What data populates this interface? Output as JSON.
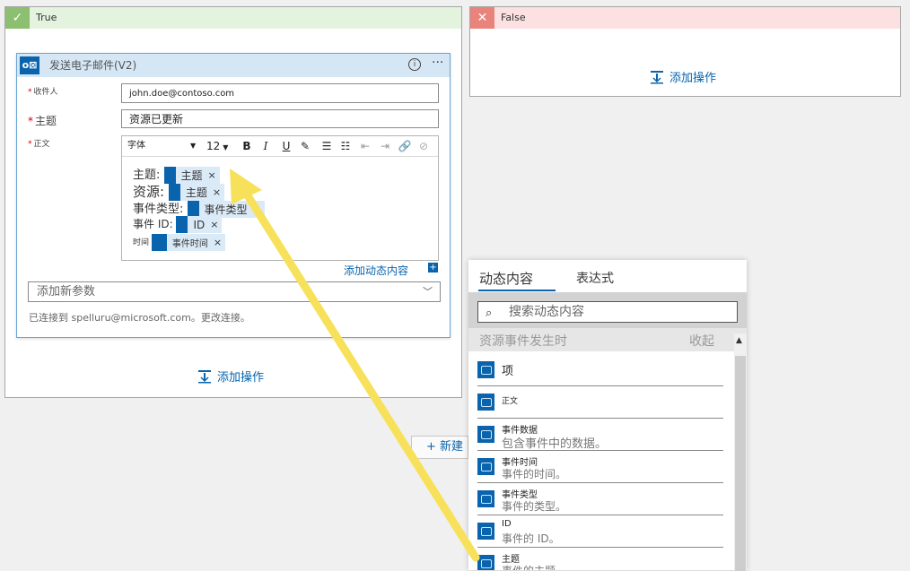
{
  "true_branch": {
    "title": "True",
    "add_action": "添加操作"
  },
  "false_branch": {
    "title": "False",
    "add_action": "添加操作"
  },
  "card": {
    "title": "发送电子邮件(V2)",
    "to_label": "收件人",
    "to_value": "john.doe@contoso.com",
    "subject_label": "主题",
    "subject_value": "资源已更新",
    "body_label": "正文",
    "toolbar": {
      "font": "字体",
      "size": "12"
    },
    "body_lines": [
      {
        "label": "主题:",
        "token": "主题"
      },
      {
        "label": "资源:",
        "token": "主题"
      },
      {
        "label": "事件类型:",
        "token": "事件类型"
      },
      {
        "label": "事件 ID:",
        "token": "ID"
      },
      {
        "label": "时间",
        "token": "事件时间"
      }
    ],
    "add_dynamic": "添加动态内容",
    "add_param": "添加新参数",
    "connection": "已连接到 spelluru@microsoft.com。更改连接。"
  },
  "new_step": "+ 新建",
  "panel": {
    "tabs": [
      "动态内容",
      "表达式"
    ],
    "search_placeholder": "搜索动态内容",
    "section": "资源事件发生时",
    "collapse": "收起",
    "items": [
      {
        "name": "项",
        "desc": ""
      },
      {
        "name": "正文",
        "desc": ""
      },
      {
        "name": "事件数据",
        "desc": "包含事件中的数据。"
      },
      {
        "name": "事件时间",
        "desc": "事件的时间。"
      },
      {
        "name": "事件类型",
        "desc": "事件的类型。"
      },
      {
        "name": "ID",
        "desc": "事件的 ID。"
      },
      {
        "name": "主题",
        "desc": "事件的主题。"
      }
    ]
  },
  "colors": {
    "true_head": "#e4f3dd",
    "true_icon": "#8cbf6f",
    "false_head": "#fbe1e1",
    "false_icon": "#e8847b",
    "accent": "#0a64ad",
    "arrow": "#f7e15b"
  }
}
